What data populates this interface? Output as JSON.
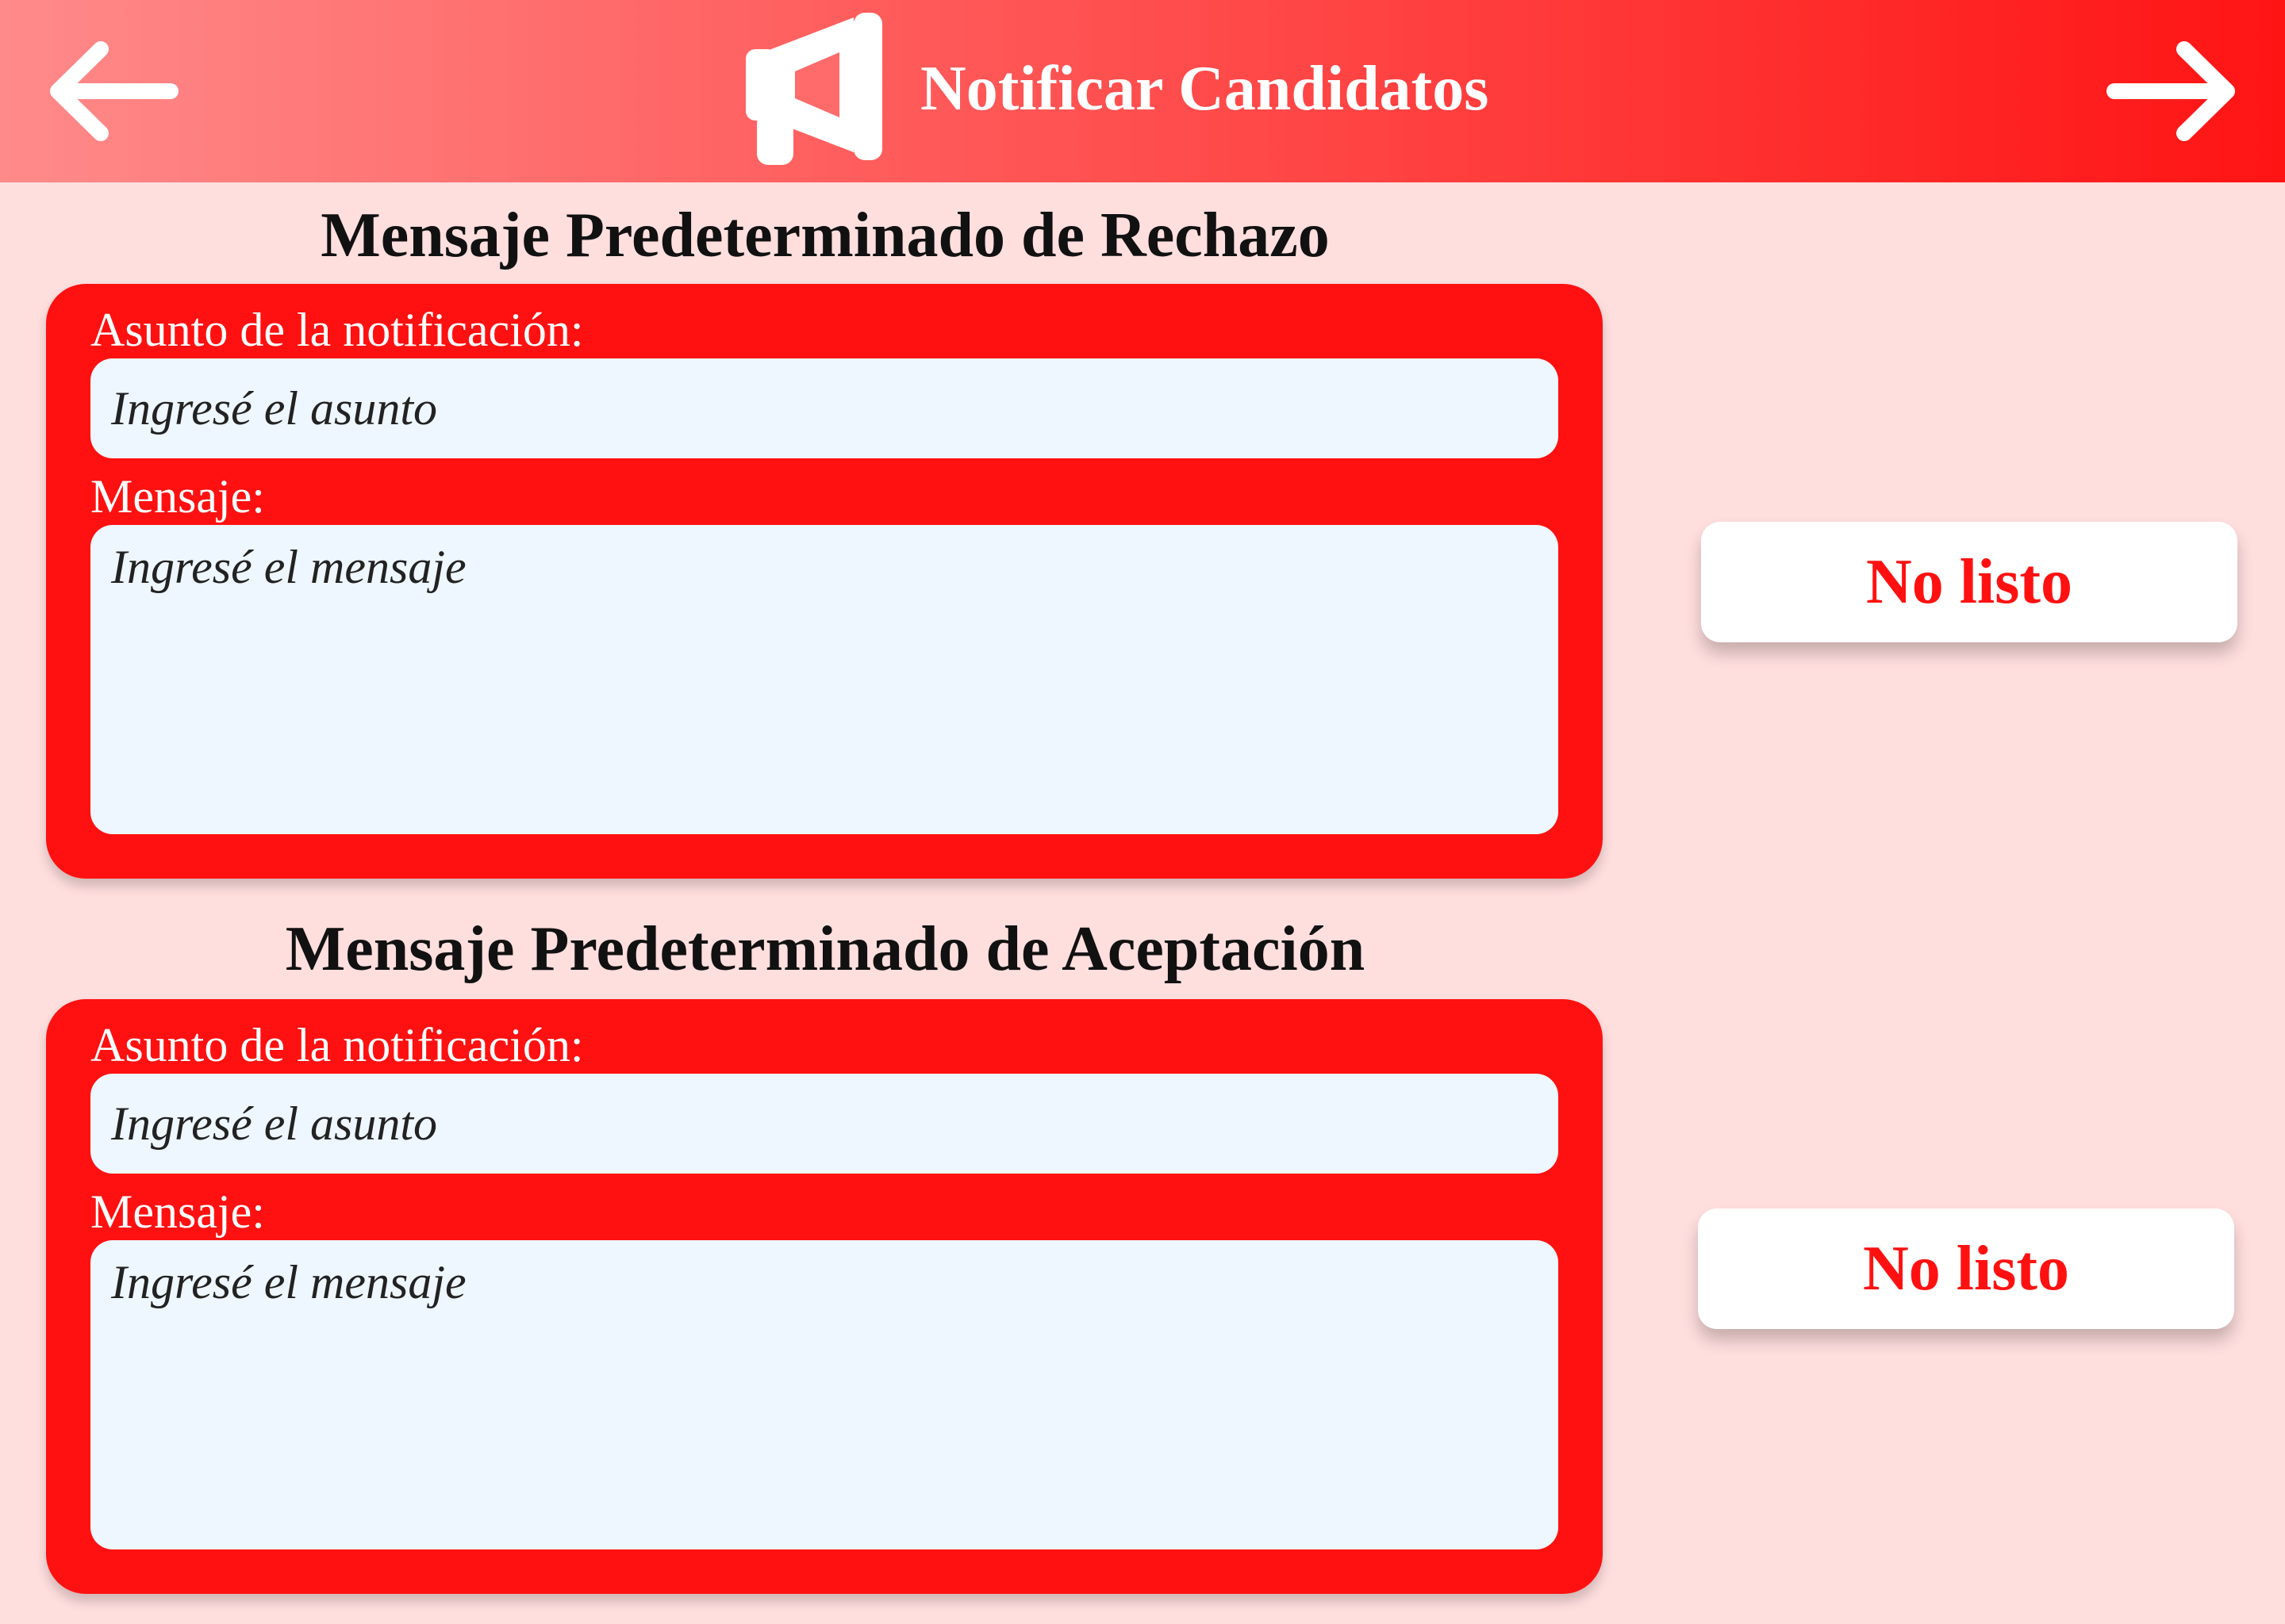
{
  "header": {
    "title": "Notificar Candidatos",
    "back_icon": "arrow-left-icon",
    "next_icon": "arrow-right-icon",
    "title_icon": "megaphone-icon"
  },
  "sections": [
    {
      "title": "Mensaje Predeterminado de Rechazo",
      "subject_label": "Asunto de la notificación:",
      "subject_placeholder": "Ingresé el asunto",
      "message_label": "Mensaje:",
      "message_placeholder": "Ingresé el mensaje",
      "status_button": "No listo"
    },
    {
      "title": "Mensaje Predeterminado de Aceptación",
      "subject_label": "Asunto de la notificación:",
      "subject_placeholder": "Ingresé el asunto",
      "message_label": "Mensaje:",
      "message_placeholder": "Ingresé el mensaje",
      "status_button": "No listo"
    }
  ],
  "colors": {
    "background": "#FFDEDE",
    "header_gradient_start": "#FF8A8A",
    "header_gradient_end": "#FF1414",
    "card": "#FF1111",
    "input_background": "#EEF6FF",
    "button_text": "#FF1111",
    "button_background": "#FFFFFF"
  }
}
